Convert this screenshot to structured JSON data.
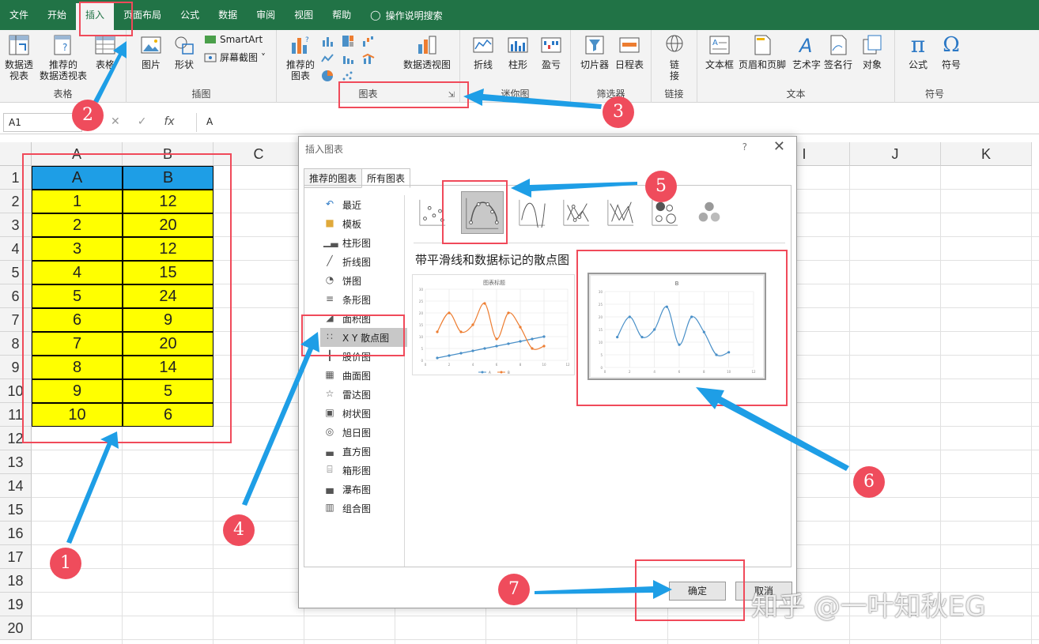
{
  "menu": {
    "items": [
      "文件",
      "开始",
      "插入",
      "页面布局",
      "公式",
      "数据",
      "审阅",
      "视图",
      "帮助"
    ],
    "active_index": 2,
    "tell_me": "操作说明搜索"
  },
  "ribbon": {
    "tables": {
      "pivot": "数据透\n视表",
      "rec_pivot": "推荐的\n数据透视表",
      "table": "表格",
      "label": "表格"
    },
    "illustrations": {
      "picture": "图片",
      "shapes": "形状",
      "smartart": "SmartArt",
      "screenshot": "屏幕截图",
      "label": "插图"
    },
    "charts": {
      "recommended": "推荐的\n图表",
      "pivot_chart": "数据透视图",
      "label": "图表"
    },
    "sparklines": {
      "line": "折线",
      "column": "柱形",
      "winloss": "盈亏",
      "label": "迷你图"
    },
    "filters": {
      "slicer": "切片器",
      "timeline": "日程表",
      "label": "筛选器"
    },
    "links": {
      "link": "链\n接",
      "label": "链接"
    },
    "text": {
      "textbox": "文本框",
      "header_footer": "页眉和页脚",
      "wordart": "艺术字",
      "signature": "签名行",
      "object": "对象",
      "label": "文本"
    },
    "symbols": {
      "equation": "公式",
      "symbol": "符号",
      "label": "符号"
    }
  },
  "formula_bar": {
    "name_box": "A1",
    "content": "A",
    "fx": "fx"
  },
  "sheet": {
    "columns": [
      "A",
      "B",
      "C",
      "D",
      "E",
      "F",
      "G",
      "H",
      "I",
      "J",
      "K"
    ],
    "rows": [
      "1",
      "2",
      "3",
      "4",
      "5",
      "6",
      "7",
      "8",
      "9",
      "10",
      "11",
      "12",
      "13",
      "14",
      "15",
      "16",
      "17",
      "18",
      "19",
      "20"
    ],
    "header_cells": [
      "A",
      "B"
    ],
    "data": [
      [
        1,
        12
      ],
      [
        2,
        20
      ],
      [
        3,
        12
      ],
      [
        4,
        15
      ],
      [
        5,
        24
      ],
      [
        6,
        9
      ],
      [
        7,
        20
      ],
      [
        8,
        14
      ],
      [
        9,
        5
      ],
      [
        10,
        6
      ]
    ],
    "colors": {
      "header_fill": "#1e9ee6",
      "data_fill": "#ffff00"
    }
  },
  "dialog": {
    "title": "插入图表",
    "help": "?",
    "tabs": [
      "推荐的图表",
      "所有图表"
    ],
    "selected_tab": 1,
    "categories": [
      {
        "label": "最近",
        "icon": "recent-icon"
      },
      {
        "label": "模板",
        "icon": "folder-icon"
      },
      {
        "label": "柱形图",
        "icon": "column-chart-icon"
      },
      {
        "label": "折线图",
        "icon": "line-chart-icon"
      },
      {
        "label": "饼图",
        "icon": "pie-chart-icon"
      },
      {
        "label": "条形图",
        "icon": "bar-chart-icon"
      },
      {
        "label": "面积图",
        "icon": "area-chart-icon"
      },
      {
        "label": "X Y 散点图",
        "icon": "scatter-chart-icon"
      },
      {
        "label": "股价图",
        "icon": "stock-chart-icon"
      },
      {
        "label": "曲面图",
        "icon": "surface-chart-icon"
      },
      {
        "label": "雷达图",
        "icon": "radar-chart-icon"
      },
      {
        "label": "树状图",
        "icon": "treemap-icon"
      },
      {
        "label": "旭日图",
        "icon": "sunburst-icon"
      },
      {
        "label": "直方图",
        "icon": "histogram-icon"
      },
      {
        "label": "箱形图",
        "icon": "boxplot-icon"
      },
      {
        "label": "瀑布图",
        "icon": "waterfall-icon"
      },
      {
        "label": "组合图",
        "icon": "combo-chart-icon"
      }
    ],
    "selected_category": 7,
    "subtype_title": "带平滑线和数据标记的散点图",
    "ok": "确定",
    "cancel": "取消"
  },
  "chart_data": [
    {
      "type": "scatter",
      "title": "图表标题",
      "series": [
        {
          "name": "A",
          "x": [
            1,
            2,
            3,
            4,
            5,
            6,
            7,
            8,
            9,
            10
          ],
          "y": [
            1,
            2,
            3,
            4,
            5,
            6,
            7,
            8,
            9,
            10
          ],
          "color": "#4a90c8"
        },
        {
          "name": "B",
          "x": [
            1,
            2,
            3,
            4,
            5,
            6,
            7,
            8,
            9,
            10
          ],
          "y": [
            12,
            20,
            12,
            15,
            24,
            9,
            20,
            14,
            5,
            6
          ],
          "color": "#ed7d31"
        }
      ],
      "xlim": [
        0,
        12
      ],
      "ylim": [
        0,
        30
      ],
      "x_ticks": [
        "0",
        "2",
        "4",
        "6",
        "8",
        "10",
        "12"
      ],
      "y_ticks": [
        "0",
        "5",
        "10",
        "15",
        "20",
        "25",
        "30"
      ],
      "legend": "bottom"
    },
    {
      "type": "scatter",
      "title": "B",
      "series": [
        {
          "name": "B",
          "x": [
            1,
            2,
            3,
            4,
            5,
            6,
            7,
            8,
            9,
            10
          ],
          "y": [
            12,
            20,
            12,
            15,
            24,
            9,
            20,
            14,
            5,
            6
          ],
          "color": "#4a90c8"
        }
      ],
      "xlim": [
        0,
        12
      ],
      "ylim": [
        0,
        30
      ],
      "x_ticks": [
        "0",
        "2",
        "4",
        "6",
        "8",
        "10",
        "12"
      ],
      "y_ticks": [
        "0",
        "5",
        "10",
        "15",
        "20",
        "25",
        "30"
      ]
    }
  ],
  "annotations": {
    "badges": [
      "1",
      "2",
      "3",
      "4",
      "5",
      "6",
      "7"
    ],
    "arrow_color": "#1e9ee6",
    "box_color": "#f04a5a"
  },
  "watermark": "知乎 @一叶知秋EG"
}
